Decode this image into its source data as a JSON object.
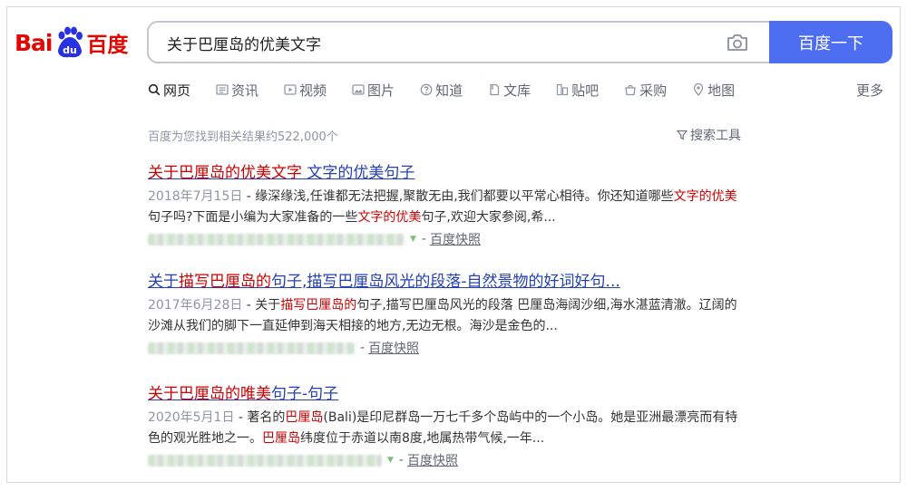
{
  "logo": {
    "latin_a": "Bai",
    "paw_text": "du",
    "chinese": "百度"
  },
  "search": {
    "query": "关于巴厘岛的优美文字",
    "button_label": "百度一下"
  },
  "tabs": [
    {
      "label": "网页",
      "icon": "search-icon",
      "active": true
    },
    {
      "label": "资讯",
      "icon": "news-icon"
    },
    {
      "label": "视频",
      "icon": "video-icon"
    },
    {
      "label": "图片",
      "icon": "image-icon"
    },
    {
      "label": "知道",
      "icon": "question-icon"
    },
    {
      "label": "文库",
      "icon": "document-icon"
    },
    {
      "label": "贴吧",
      "icon": "forum-icon"
    },
    {
      "label": "采购",
      "icon": "shopping-icon"
    },
    {
      "label": "地图",
      "icon": "map-icon"
    }
  ],
  "tab_more": "更多",
  "result_count": "百度为您找到相关结果约522,000个",
  "search_tools": "搜索工具",
  "results": [
    {
      "title_hl": "关于巴厘岛的优美文字",
      "title_rest": " 文字的优美句子",
      "date": "2018年7月15日",
      "desc_a": " - 缘深缘浅,任谁都无法把握,聚散无由,我们都要以平常心相待。你还知道哪些",
      "desc_hl1": "文字的优美",
      "desc_b": "句子吗?下面是小编为大家准备的一些",
      "desc_hl2": "文字的优美",
      "desc_c": "句子,欢迎大家参阅,希...",
      "sep": "-",
      "snapshot": "百度快照"
    },
    {
      "title_a": "关于",
      "title_hl": "描写巴厘岛的",
      "title_rest": "句子,描写巴厘岛风光的段落-自然景物的好词好句...",
      "date": "2017年6月28日",
      "desc_a": " - 关于",
      "desc_hl1": "描写巴厘岛的",
      "desc_b": "句子,描写巴厘岛风光的段落 巴厘岛海阔沙细,海水湛蓝清澈。辽阔的沙滩从我们的脚下一直延伸到海天相接的地方,无边无根。海沙是金色的...",
      "sep": "-",
      "snapshot": "百度快照"
    },
    {
      "title_hl": "关于巴厘岛的唯美",
      "title_rest": "句子-句子",
      "date": "2020年5月1日",
      "desc_a": " - 著名的",
      "desc_hl1": "巴厘岛",
      "desc_b": "(Bali)是印尼群岛一万七千多个岛屿中的一个小岛。她是亚洲最漂亮而有特色的观光胜地之一。",
      "desc_hl2": "巴厘岛",
      "desc_c": "纬度位于赤道以南8度,地属热带气候,一年...",
      "sep": "-",
      "snapshot": "百度快照"
    }
  ],
  "colors": {
    "brand_red": "#e10602",
    "brand_blue": "#2932e1",
    "button_blue": "#4e6ef2",
    "link_blue": "#2440b3",
    "highlight_red": "#cc0000"
  }
}
